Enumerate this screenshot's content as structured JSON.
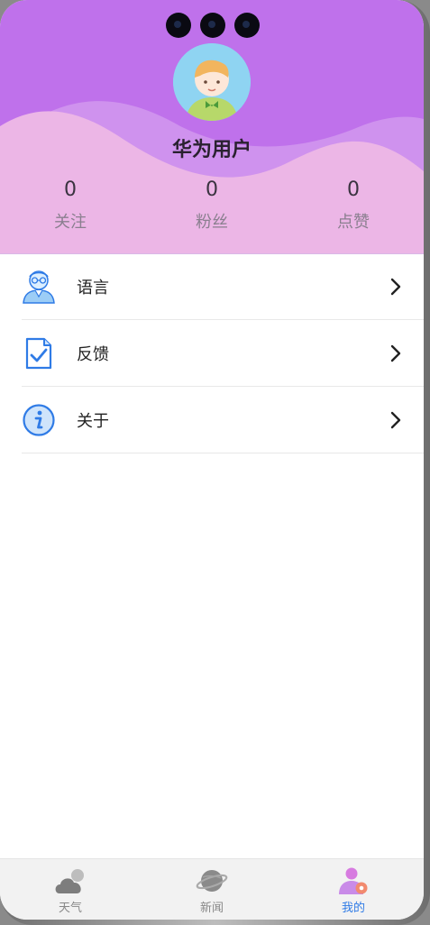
{
  "profile": {
    "username": "华为用户",
    "stats": [
      {
        "value": "0",
        "label": "关注"
      },
      {
        "value": "0",
        "label": "粉丝"
      },
      {
        "value": "0",
        "label": "点赞"
      }
    ]
  },
  "menu": {
    "items": [
      {
        "label": "语言",
        "icon": "user-glasses-icon"
      },
      {
        "label": "反馈",
        "icon": "checklist-document-icon"
      },
      {
        "label": "关于",
        "icon": "info-icon"
      }
    ]
  },
  "tabbar": {
    "tabs": [
      {
        "label": "天气",
        "icon": "cloud-icon",
        "active": false
      },
      {
        "label": "新闻",
        "icon": "planet-icon",
        "active": false
      },
      {
        "label": "我的",
        "icon": "user-settings-icon",
        "active": true
      }
    ]
  },
  "colors": {
    "header_bg": "#bf71eb",
    "wave_light": "#ecb6e6",
    "active_tab": "#2f7be6"
  }
}
